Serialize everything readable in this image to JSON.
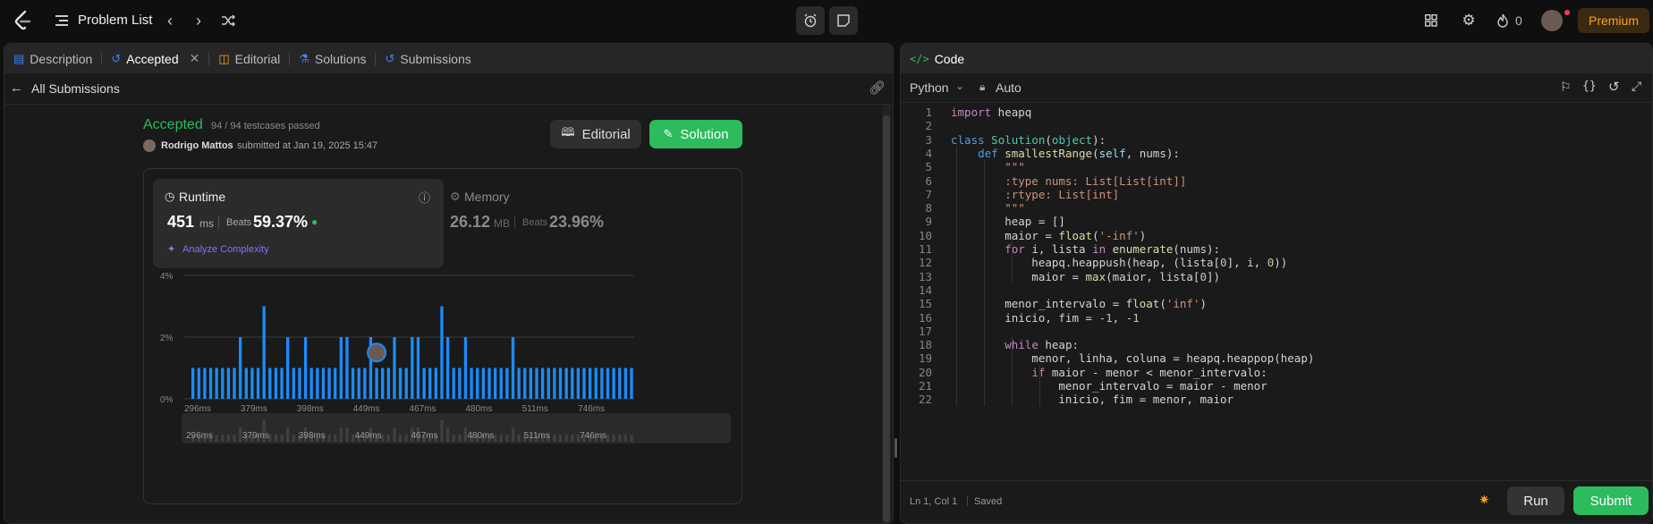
{
  "header": {
    "problem_list": "Problem List",
    "streak_count": "0",
    "premium_label": "Premium",
    "accent": "#ffa116"
  },
  "left_panel": {
    "tabs": [
      {
        "label": "Description",
        "icon": "description-icon"
      },
      {
        "label": "Accepted",
        "icon": "history-icon"
      },
      {
        "label": "Editorial",
        "icon": "book-icon"
      },
      {
        "label": "Solutions",
        "icon": "flask-icon"
      },
      {
        "label": "Submissions",
        "icon": "history-icon"
      }
    ],
    "back_label": "All Submissions"
  },
  "submission": {
    "status": "Accepted",
    "testcases": "94 / 94 testcases passed",
    "user": "Rodrigo Mattos",
    "submitted_text": "submitted at Jan 19, 2025 15:47",
    "editorial_button": "Editorial",
    "solution_button": "Solution",
    "runtime": {
      "title": "Runtime",
      "value": "451",
      "unit": "ms",
      "beats_label": "Beats",
      "beats_value": "59.37%"
    },
    "analyze_label": "Analyze Complexity",
    "memory": {
      "title": "Memory",
      "value": "26.12",
      "unit": "MB",
      "beats_label": "Beats",
      "beats_value": "23.96%"
    },
    "colors": {
      "accepted": "#2cbb5d",
      "bar": "#1a8cff",
      "analyze": "#a76bff"
    }
  },
  "chart_data": {
    "type": "bar",
    "ylim": [
      0,
      4
    ],
    "ytick_labels": [
      "4%",
      "2%",
      "0%"
    ],
    "xtick_labels": [
      "296ms",
      "379ms",
      "398ms",
      "449ms",
      "467ms",
      "480ms",
      "511ms",
      "746ms"
    ],
    "values": [
      1,
      1,
      1,
      1,
      1,
      1,
      1,
      1,
      2,
      1,
      1,
      1,
      3,
      1,
      1,
      1,
      2,
      1,
      1,
      2,
      1,
      1,
      1,
      1,
      1,
      2,
      2,
      1,
      1,
      1,
      2,
      1,
      1,
      1,
      2,
      1,
      1,
      2,
      2,
      1,
      1,
      1,
      3,
      2,
      1,
      1,
      2,
      1,
      1,
      1,
      1,
      1,
      1,
      1,
      2,
      1,
      1,
      1,
      1,
      1,
      1,
      1,
      1,
      1,
      1,
      1,
      1,
      1,
      1,
      1,
      1,
      1,
      1,
      1,
      1
    ],
    "highlight_index": 31
  },
  "right_panel": {
    "tab_label": "Code",
    "language": "Python",
    "auto_label": "Auto",
    "status_position": "Ln 1, Col 1",
    "status_saved": "Saved",
    "run_button": "Run",
    "submit_button": "Submit"
  },
  "code_lines": [
    "import heapq",
    "",
    "class Solution(object):",
    "    def smallestRange(self, nums):",
    "        \"\"\"",
    "        :type nums: List[List[int]]",
    "        :rtype: List[int]",
    "        \"\"\"",
    "        heap = []",
    "        maior = float('-inf')",
    "        for i, lista in enumerate(nums):",
    "            heapq.heappush(heap, (lista[0], i, 0))",
    "            maior = max(maior, lista[0])",
    "",
    "        menor_intervalo = float('inf')",
    "        inicio, fim = -1, -1",
    "",
    "        while heap:",
    "            menor, linha, coluna = heapq.heappop(heap)",
    "            if maior - menor < menor_intervalo:",
    "                menor_intervalo = maior - menor",
    "                inicio, fim = menor, maior"
  ]
}
